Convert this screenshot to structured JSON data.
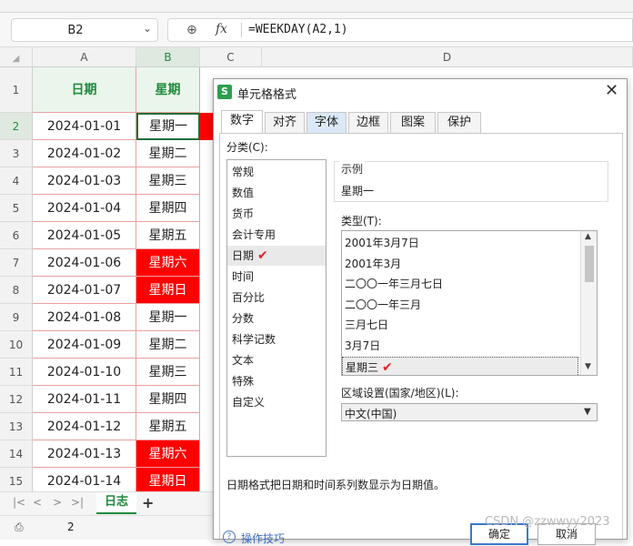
{
  "formula_bar": {
    "name_box": "B2",
    "fx_label": "fx",
    "formula": "=WEEKDAY(A2,1)"
  },
  "columns": [
    "A",
    "B",
    "C",
    "D"
  ],
  "header_row": {
    "row": "1",
    "a": "日期",
    "b": "星期"
  },
  "rows": [
    {
      "row": "2",
      "date": "2024-01-01",
      "weekday": "星期一",
      "weekend": false
    },
    {
      "row": "3",
      "date": "2024-01-02",
      "weekday": "星期二",
      "weekend": false
    },
    {
      "row": "4",
      "date": "2024-01-03",
      "weekday": "星期三",
      "weekend": false
    },
    {
      "row": "5",
      "date": "2024-01-04",
      "weekday": "星期四",
      "weekend": false
    },
    {
      "row": "6",
      "date": "2024-01-05",
      "weekday": "星期五",
      "weekend": false
    },
    {
      "row": "7",
      "date": "2024-01-06",
      "weekday": "星期六",
      "weekend": true
    },
    {
      "row": "8",
      "date": "2024-01-07",
      "weekday": "星期日",
      "weekend": true
    },
    {
      "row": "9",
      "date": "2024-01-08",
      "weekday": "星期一",
      "weekend": false
    },
    {
      "row": "10",
      "date": "2024-01-09",
      "weekday": "星期二",
      "weekend": false
    },
    {
      "row": "11",
      "date": "2024-01-10",
      "weekday": "星期三",
      "weekend": false
    },
    {
      "row": "12",
      "date": "2024-01-11",
      "weekday": "星期四",
      "weekend": false
    },
    {
      "row": "13",
      "date": "2024-01-12",
      "weekday": "星期五",
      "weekend": false
    },
    {
      "row": "14",
      "date": "2024-01-13",
      "weekday": "星期六",
      "weekend": true
    },
    {
      "row": "15",
      "date": "2024-01-14",
      "weekday": "星期日",
      "weekend": true
    }
  ],
  "sheet_tabs": {
    "active": "日志",
    "add": "+"
  },
  "status_bar": {
    "count": "2"
  },
  "dialog": {
    "logo": "S",
    "title": "单元格格式",
    "close": "✕",
    "tabs": [
      "数字",
      "对齐",
      "字体",
      "边框",
      "图案",
      "保护"
    ],
    "category_label": "分类(C):",
    "categories": [
      "常规",
      "数值",
      "货币",
      "会计专用",
      "日期",
      "时间",
      "百分比",
      "分数",
      "科学记数",
      "文本",
      "特殊",
      "自定义"
    ],
    "selected_category": "日期",
    "sample_label": "示例",
    "sample_value": "星期一",
    "type_label": "类型(T):",
    "types": [
      "2001年3月7日",
      "2001年3月",
      "二〇〇一年三月七日",
      "二〇〇一年三月",
      "三月七日",
      "3月7日",
      "星期三"
    ],
    "selected_type": "星期三",
    "region_label": "区域设置(国家/地区)(L):",
    "region_value": "中文(中国)",
    "description": "日期格式把日期和时间系列数显示为日期值。",
    "tips": "操作技巧",
    "ok": "确定",
    "cancel": "取消"
  },
  "watermark": "CSDN @zzwwyy2023",
  "colors": {
    "accent_green": "#1f8a3c",
    "weekend_red": "#ff0000",
    "check_red": "#e0202a"
  }
}
